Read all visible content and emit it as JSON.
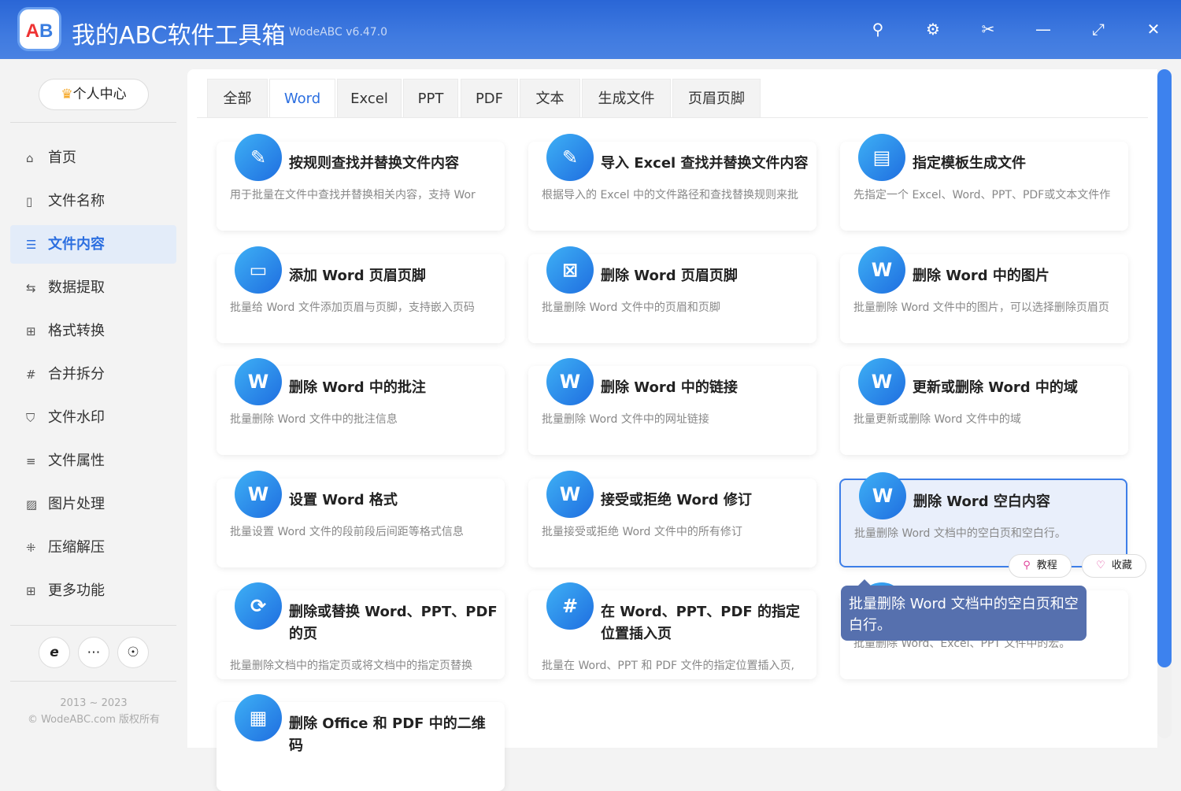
{
  "app": {
    "title": "我的ABC软件工具箱",
    "version": "WodeABC v6.47.0",
    "logo_text": "AB"
  },
  "titlebar_icons": [
    "search-icon",
    "gear-icon",
    "scissors-icon",
    "minimize-icon",
    "maximize-icon",
    "close-icon"
  ],
  "sidebar": {
    "user_center": "个人中心",
    "items": [
      {
        "label": "首页",
        "icon": "home-icon"
      },
      {
        "label": "文件名称",
        "icon": "file-name-icon"
      },
      {
        "label": "文件内容",
        "icon": "file-content-icon",
        "active": true
      },
      {
        "label": "数据提取",
        "icon": "extract-icon"
      },
      {
        "label": "格式转换",
        "icon": "convert-icon"
      },
      {
        "label": "合并拆分",
        "icon": "merge-icon"
      },
      {
        "label": "文件水印",
        "icon": "watermark-icon"
      },
      {
        "label": "文件属性",
        "icon": "properties-icon"
      },
      {
        "label": "图片处理",
        "icon": "image-icon"
      },
      {
        "label": "压缩解压",
        "icon": "compress-icon"
      },
      {
        "label": "更多功能",
        "icon": "more-icon"
      }
    ],
    "footer_years": "2013 ~ 2023",
    "footer_copy": "© WodeABC.com 版权所有"
  },
  "tabs": [
    "全部",
    "Word",
    "Excel",
    "PPT",
    "PDF",
    "文本",
    "生成文件",
    "页眉页脚"
  ],
  "active_tab": "Word",
  "cards": [
    {
      "title": "按规则查找并替换文件内容",
      "desc": "用于批量在文件中查找并替换相关内容，支持 Wor"
    },
    {
      "title": "导入 Excel 查找并替换文件内容",
      "desc": "根据导入的 Excel 中的文件路径和查找替换规则来批"
    },
    {
      "title": "指定模板生成文件",
      "desc": "先指定一个 Excel、Word、PPT、PDF或文本文件作"
    },
    {
      "title": "添加 Word 页眉页脚",
      "desc": "批量给 Word 文件添加页眉与页脚，支持嵌入页码"
    },
    {
      "title": "删除 Word 页眉页脚",
      "desc": "批量删除 Word 文件中的页眉和页脚"
    },
    {
      "title": "删除 Word 中的图片",
      "desc": "批量删除 Word 文件中的图片，可以选择删除页眉页"
    },
    {
      "title": "删除 Word 中的批注",
      "desc": "批量删除 Word 文件中的批注信息"
    },
    {
      "title": "删除 Word 中的链接",
      "desc": "批量删除 Word 文件中的网址链接"
    },
    {
      "title": "更新或删除 Word 中的域",
      "desc": "批量更新或删除 Word 文件中的域"
    },
    {
      "title": "设置 Word 格式",
      "desc": "批量设置 Word 文件的段前段后间距等格式信息"
    },
    {
      "title": "接受或拒绝 Word 修订",
      "desc": "批量接受或拒绝 Word 文件中的所有修订"
    },
    {
      "title": "删除 Word 空白内容",
      "desc": "批量删除 Word 文档中的空白页和空白行。",
      "highlight": true
    },
    {
      "title": "删除或替换 Word、PPT、PDF 的页",
      "desc": "批量删除文档中的指定页或将文档中的指定页替换"
    },
    {
      "title": "在 Word、PPT、PDF 的指定位置插入页",
      "desc": "批量在 Word、PPT 和 PDF 文件的指定位置插入页,"
    },
    {
      "title": "",
      "desc": "批量删除 Word、Excel、PPT 文件中的宏。"
    },
    {
      "title": "删除 Office 和 PDF 中的二维码",
      "desc": ""
    }
  ],
  "hover_actions": {
    "tutorial": "教程",
    "favorite": "收藏"
  },
  "tooltip": "批量删除 Word 文档中的空白页和空白行。",
  "colors": {
    "accent": "#2c6fe0",
    "titlebar": "#2a66d6",
    "tooltip": "#5670ae"
  }
}
